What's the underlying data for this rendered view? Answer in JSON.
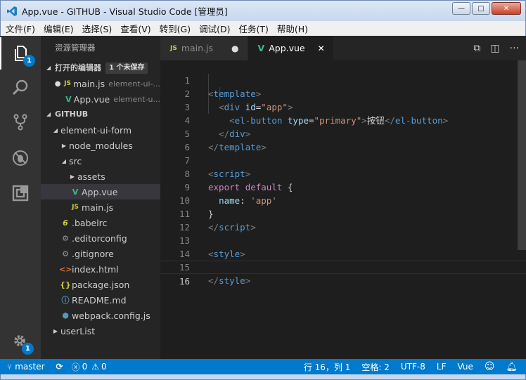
{
  "window": {
    "title": "App.vue - GITHUB - Visual Studio Code [管理员]",
    "minimize": "—",
    "maximize": "□",
    "close": "✕"
  },
  "menu": [
    "文件(F)",
    "编辑(E)",
    "选择(S)",
    "查看(V)",
    "转到(G)",
    "调试(D)",
    "任务(T)",
    "帮助(H)"
  ],
  "activity": {
    "explorer_badge": "1",
    "settings_badge": "1"
  },
  "sidebar": {
    "title": "资源管理器",
    "open_editors": {
      "label": "打开的编辑器",
      "unsaved": "1 个未保存",
      "items": [
        {
          "icon": "JS",
          "name": "main.js",
          "desc": "element-ui-..."
        },
        {
          "icon": "V",
          "name": "App.vue",
          "desc": "element-u..."
        }
      ]
    },
    "workspace": {
      "label": "GITHUB",
      "tree": [
        {
          "name": "element-ui-form",
          "icon": ""
        },
        {
          "name": "node_modules",
          "icon": ""
        },
        {
          "name": "src",
          "icon": ""
        },
        {
          "name": "assets",
          "icon": ""
        },
        {
          "name": "App.vue",
          "icon": "V"
        },
        {
          "name": "main.js",
          "icon": "JS"
        },
        {
          "name": ".babelrc",
          "icon": "6"
        },
        {
          "name": ".editorconfig",
          "icon": "⚙"
        },
        {
          "name": ".gitignore",
          "icon": "⚙"
        },
        {
          "name": "index.html",
          "icon": "<>"
        },
        {
          "name": "package.json",
          "icon": "{}"
        },
        {
          "name": "README.md",
          "icon": "ⓘ"
        },
        {
          "name": "webpack.config.js",
          "icon": "⬢"
        },
        {
          "name": "userList",
          "icon": ""
        }
      ]
    }
  },
  "tabs": [
    {
      "icon": "JS",
      "name": "main.js",
      "close": "●"
    },
    {
      "icon": "V",
      "name": "App.vue",
      "close": "✕"
    }
  ],
  "code": {
    "line_numbers": [
      "1",
      "2",
      "3",
      "4",
      "5",
      "6",
      "7",
      "8",
      "9",
      "10",
      "11",
      "12",
      "13",
      "14",
      "15",
      "16"
    ],
    "tokens": {
      "l1": [
        "<",
        "template",
        ">"
      ],
      "l2": [
        "<",
        "div",
        "id",
        "=",
        "\"app\"",
        ">"
      ],
      "l3": [
        "<",
        "el-button",
        "type",
        "=",
        "\"primary\"",
        ">",
        "按钮",
        "</",
        "el-button",
        ">"
      ],
      "l4": [
        "</",
        "div",
        ">"
      ],
      "l5": [
        "</",
        "template",
        ">"
      ],
      "l7": [
        "<",
        "script",
        ">"
      ],
      "l8": [
        "export",
        "default",
        "{"
      ],
      "l9": [
        "name",
        ":",
        "'app'"
      ],
      "l10": [
        "}"
      ],
      "l11": [
        "</",
        "script",
        ">"
      ],
      "l13": [
        "<",
        "style",
        ">"
      ],
      "l15": [
        "</",
        "style",
        ">"
      ]
    }
  },
  "status": {
    "branch": "master",
    "errors": "0",
    "warnings": "0",
    "position": "行 16，列 1",
    "spaces": "空格: 2",
    "encoding": "UTF-8",
    "eol": "LF",
    "language": "Vue"
  }
}
